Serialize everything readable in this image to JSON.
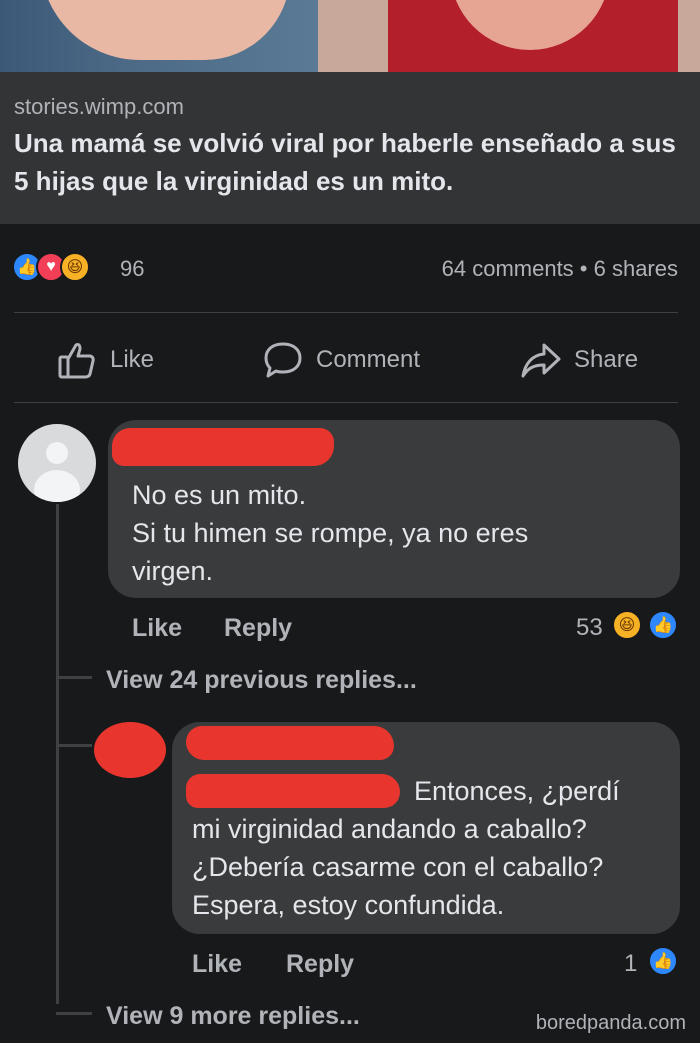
{
  "link_preview": {
    "domain": "stories.wimp.com",
    "headline": "Una mamá se volvió viral por haberle enseñado a sus 5 hijas que la virginidad es un mito."
  },
  "reactions": {
    "count": "96",
    "icons": [
      "like-icon",
      "love-icon",
      "haha-icon"
    ],
    "stats": "64 comments • 6 shares"
  },
  "actions": {
    "like": "Like",
    "comment": "Comment",
    "share": "Share"
  },
  "comment1": {
    "text_lines": [
      "No es un mito.",
      "Si tu himen se rompe, ya no eres",
      "virgen."
    ],
    "like": "Like",
    "reply": "Reply",
    "reaction_count": "53",
    "reaction_icons": [
      "haha-icon",
      "like-icon"
    ]
  },
  "view_previous": "View 24 previous replies...",
  "comment2": {
    "text_lines": [
      "Entonces, ¿perdí",
      "mi virginidad andando a caballo?",
      "¿Debería casarme con el caballo?",
      "Espera, estoy confundida."
    ],
    "like": "Like",
    "reply": "Reply",
    "reaction_count": "1",
    "reaction_icons": [
      "like-icon"
    ]
  },
  "view_more": "View 9 more replies...",
  "watermark": "boredpanda.com",
  "colors": {
    "background": "#18191b",
    "bubble": "#3a3b3c",
    "redaction": "#e8362f",
    "like_blue": "#2d88ff",
    "love_red": "#f33e58",
    "haha_yellow": "#f7b125"
  }
}
